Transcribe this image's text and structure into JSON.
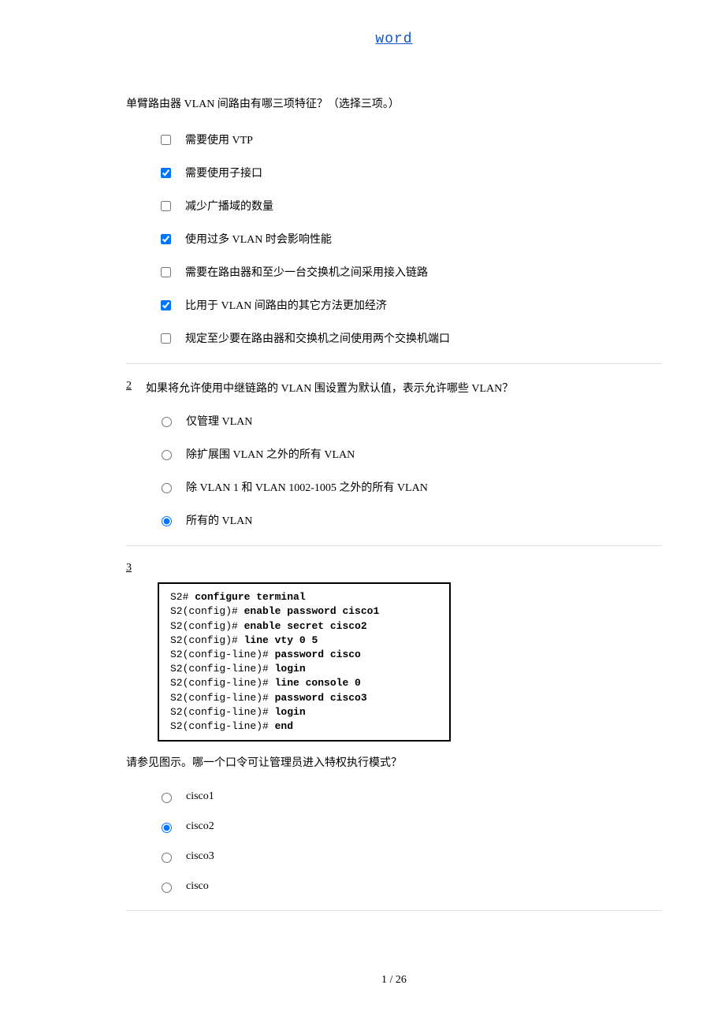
{
  "header": {
    "link_text": "word"
  },
  "q1": {
    "text": "单臂路由器 VLAN 间路由有哪三项特征？（选择三项。）",
    "opts": [
      {
        "label": "需要使用 VTP",
        "checked": false
      },
      {
        "label": "需要使用子接口",
        "checked": true
      },
      {
        "label": "减少广播域的数量",
        "checked": false
      },
      {
        "label": "使用过多 VLAN 时会影响性能",
        "checked": true
      },
      {
        "label": "需要在路由器和至少一台交换机之间采用接入链路",
        "checked": false
      },
      {
        "label": "比用于 VLAN 间路由的其它方法更加经济",
        "checked": true
      },
      {
        "label": "规定至少要在路由器和交换机之间使用两个交换机端口",
        "checked": false
      }
    ]
  },
  "q2": {
    "number": "2",
    "text": "如果将允许使用中继链路的 VLAN 围设置为默认值，表示允许哪些 VLAN？",
    "opts": [
      {
        "label": "仅管理 VLAN",
        "checked": false
      },
      {
        "label": "除扩展围 VLAN 之外的所有 VLAN",
        "checked": false
      },
      {
        "label": "除 VLAN 1 和 VLAN 1002-1005 之外的所有 VLAN",
        "checked": false
      },
      {
        "label": "所有的 VLAN",
        "checked": true
      }
    ]
  },
  "q3": {
    "number": "3",
    "code_lines": [
      {
        "prompt": "S2# ",
        "cmd": "configure terminal"
      },
      {
        "prompt": "S2(config)# ",
        "cmd": "enable password cisco1"
      },
      {
        "prompt": "S2(config)# ",
        "cmd": "enable secret cisco2"
      },
      {
        "prompt": "S2(config)# ",
        "cmd": "line vty 0 5"
      },
      {
        "prompt": "S2(config-line)# ",
        "cmd": "password cisco"
      },
      {
        "prompt": "S2(config-line)# ",
        "cmd": "login"
      },
      {
        "prompt": "S2(config-line)# ",
        "cmd": "line console 0"
      },
      {
        "prompt": "S2(config-line)# ",
        "cmd": "password cisco3"
      },
      {
        "prompt": "S2(config-line)# ",
        "cmd": "login"
      },
      {
        "prompt": "S2(config-line)# ",
        "cmd": "end"
      }
    ],
    "text": "请参见图示。哪一个口令可让管理员进入特权执行模式？",
    "opts": [
      {
        "label": "cisco1",
        "checked": false
      },
      {
        "label": "cisco2",
        "checked": true
      },
      {
        "label": "cisco3",
        "checked": false
      },
      {
        "label": "cisco",
        "checked": false
      }
    ]
  },
  "footer": {
    "page": "1 / 26"
  }
}
